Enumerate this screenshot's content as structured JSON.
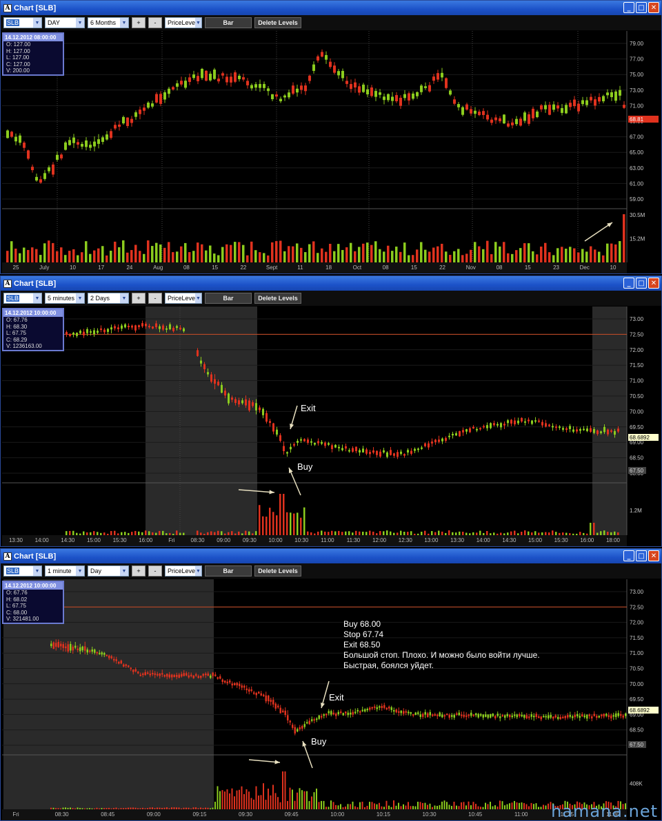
{
  "colors": {
    "up": "#8ccc1e",
    "down": "#e0321e",
    "grid": "#333333",
    "session": "#2a2a2a",
    "level": "#d0502a"
  },
  "windows": [
    {
      "title": "Chart [SLB]",
      "symbol": "SLB",
      "interval": "DAY",
      "range": "6 Months",
      "study": "PriceLeve",
      "plus": "+",
      "minus": "-",
      "chart_type": "Bar",
      "delete_levels": "Delete Levels",
      "info": {
        "date": "14.12.2012 08:00:00",
        "o": "O: 127.00",
        "h": "H: 127.00",
        "l": "L: 127.00",
        "c": "C: 127.00",
        "v": "V: 200.00"
      },
      "price_labels": [
        "79.00",
        "77.00",
        "75.00",
        "73.00",
        "71.00",
        "69.00",
        "67.00",
        "65.00",
        "63.00",
        "61.00",
        "59.00"
      ],
      "last_price": "68.81",
      "volume_labels": [
        "30.5M",
        "15.2M"
      ],
      "x_labels": [
        "25",
        "July",
        "10",
        "17",
        "24",
        "Aug",
        "08",
        "15",
        "22",
        "Sept",
        "11",
        "18",
        "Oct",
        "08",
        "15",
        "22",
        "Nov",
        "08",
        "15",
        "23",
        "Dec",
        "10"
      ]
    },
    {
      "title": "Chart [SLB]",
      "symbol": "SLB",
      "interval": "5 minutes",
      "range": "2 Days",
      "study": "PriceLeve",
      "plus": "+",
      "minus": "-",
      "chart_type": "Bar",
      "delete_levels": "Delete Levels",
      "info": {
        "date": "14.12.2012 10:00:00",
        "o": "O: 67.76",
        "h": "H: 68.30",
        "l": "L: 67.75",
        "c": "C: 68.29",
        "v": "V: 1236163.00"
      },
      "price_labels": [
        "73.00",
        "72.50",
        "72.00",
        "71.50",
        "71.00",
        "70.50",
        "70.00",
        "69.50",
        "69.00",
        "68.50",
        "68.00"
      ],
      "last_price": "68.6892",
      "cursor_price": "67.50",
      "volume_labels": [
        "1.2M"
      ],
      "x_labels": [
        "13:30",
        "14:00",
        "14:30",
        "15:00",
        "15:30",
        "16:00",
        "Fri",
        "08:30",
        "09:00",
        "09:30",
        "10:00",
        "10:30",
        "11:00",
        "11:30",
        "12:00",
        "12:30",
        "13:00",
        "13:30",
        "14:00",
        "14:30",
        "15:00",
        "15:30",
        "16:00",
        "18:00"
      ],
      "annotations": {
        "exit": "Exit",
        "buy": "Buy"
      }
    },
    {
      "title": "Chart [SLB]",
      "symbol": "SLB",
      "interval": "1 minute",
      "range": "Day",
      "study": "PriceLeve",
      "plus": "+",
      "minus": "-",
      "chart_type": "Bar",
      "delete_levels": "Delete Levels",
      "info": {
        "date": "14.12.2012 10:00:00",
        "o": "O: 67.76",
        "h": "H: 68.02",
        "l": "L: 67.75",
        "c": "C: 68.00",
        "v": "V: 321481.00"
      },
      "price_labels": [
        "73.00",
        "72.50",
        "72.00",
        "71.50",
        "71.00",
        "70.50",
        "70.00",
        "69.50",
        "69.00",
        "68.50",
        "68.00"
      ],
      "last_price": "68.6892",
      "cursor_price": "67.50",
      "volume_labels": [
        "408K"
      ],
      "x_labels": [
        "Fri",
        "08:30",
        "08:45",
        "09:00",
        "09:15",
        "09:30",
        "09:45",
        "10:00",
        "10:15",
        "10:30",
        "10:45",
        "11:00",
        "11:15",
        "11:30"
      ],
      "annotations": {
        "exit": "Exit",
        "buy": "Buy"
      },
      "note": [
        "Buy 68.00",
        "Stop 67.74",
        "Exit 68.50",
        "Большой стоп. Плохо. И можно было войти лучше.",
        "Быстрая, боялся уйдет."
      ]
    }
  ],
  "watermark": "hamana.net"
}
